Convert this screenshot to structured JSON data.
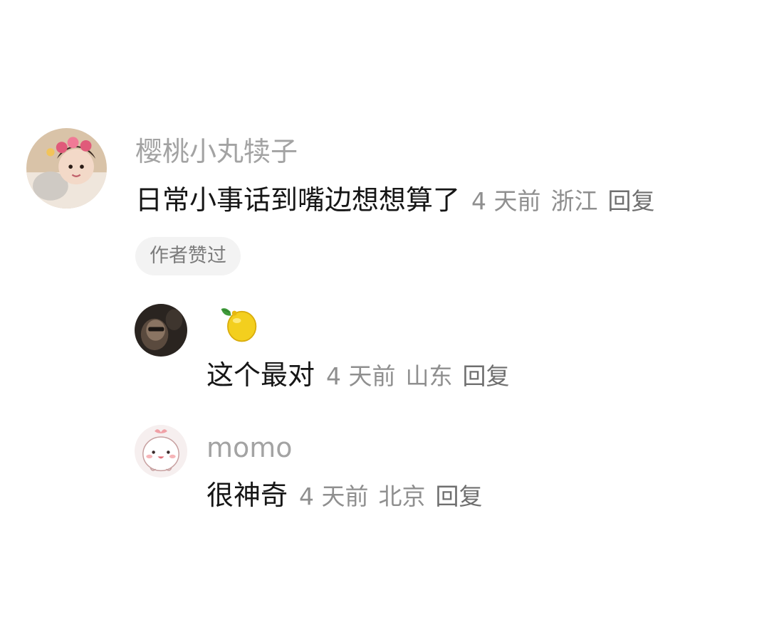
{
  "comments": [
    {
      "author": "樱桃小丸犊子",
      "text": "日常小事话到嘴边想想算了",
      "time": "4 天前",
      "location": "浙江",
      "reply_label": "回复",
      "badge": "作者赞过",
      "avatar_icon": "girl-avatar"
    },
    {
      "author_icon": "lemon-icon",
      "text": "这个最对",
      "time": "4 天前",
      "location": "山东",
      "reply_label": "回复",
      "avatar_icon": "dark-photo-avatar"
    },
    {
      "author": "momo",
      "text": "很神奇",
      "time": "4 天前",
      "location": "北京",
      "reply_label": "回复",
      "avatar_icon": "cute-bun-avatar"
    }
  ],
  "colors": {
    "name": "#a3a3a3",
    "text": "#161616",
    "meta": "#8f8f8f",
    "reply": "#6f6f6f",
    "badge_bg": "#f3f3f3"
  }
}
